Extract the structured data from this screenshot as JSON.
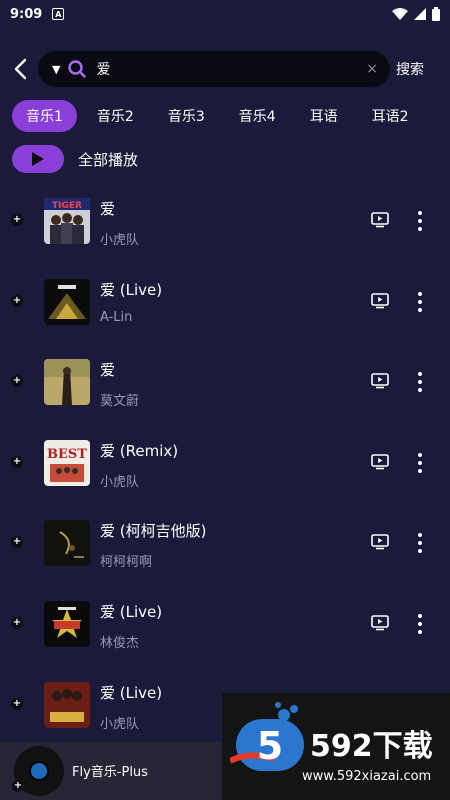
{
  "status_bar": {
    "time": "9:09",
    "app_icon": "A"
  },
  "search": {
    "query": "爱",
    "dropdown_icon": "caret-down-icon",
    "clear_symbol": "×",
    "submit_label": "搜索"
  },
  "tabs": [
    {
      "label": "音乐1",
      "active": true
    },
    {
      "label": "音乐2",
      "active": false
    },
    {
      "label": "音乐3",
      "active": false
    },
    {
      "label": "音乐4",
      "active": false
    },
    {
      "label": "耳语",
      "active": false
    },
    {
      "label": "耳语2",
      "active": false
    }
  ],
  "play_all": {
    "label": "全部播放"
  },
  "songs": [
    {
      "title": "爱",
      "artist": "小虎队"
    },
    {
      "title": "爱 (Live)",
      "artist": "A-Lin"
    },
    {
      "title": "爱",
      "artist": "莫文蔚"
    },
    {
      "title": "爱 (Remix)",
      "artist": "小虎队"
    },
    {
      "title": "爱 (柯柯吉他版)",
      "artist": "柯柯柯啊"
    },
    {
      "title": "爱 (Live)",
      "artist": "林俊杰"
    },
    {
      "title": "爱 (Live)",
      "artist": "小虎队"
    }
  ],
  "mini_player": {
    "title": "Fly音乐-Plus"
  },
  "watermark": {
    "brand": "592下载",
    "url": "www.592xiazai.com",
    "logo_digit": "5"
  },
  "colors": {
    "background": "#1c1a3a",
    "accent": "#8b3fd9",
    "secondary_text": "#9a98b0"
  }
}
